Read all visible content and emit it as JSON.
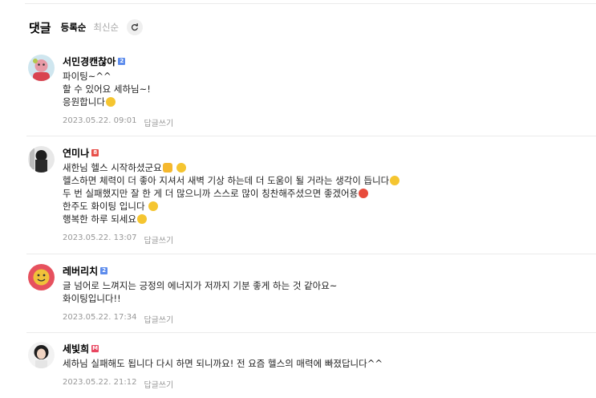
{
  "header": {
    "title": "댓글",
    "sort_options": [
      "등록순",
      "최신순"
    ],
    "active_sort": "등록순"
  },
  "comments": [
    {
      "nickname": "서민경캔찮아",
      "badge": "2",
      "badge_color": "#5d8cec",
      "lines": [
        "파이팅~^^",
        "할 수 있어요 세하님~!",
        "응원합니다"
      ],
      "date": "2023.05.22. 09:01",
      "reply_label": "답글쓰기"
    },
    {
      "nickname": "연미나",
      "badge": "8",
      "badge_color": "#e8504a",
      "lines": [
        "새한님 헬스 시작하셨군요",
        "헬스하면 체력이 더 좋아 지셔서 새벽 기상 하는데 더 도움이 될 거라는 생각이 듭니다",
        "두 번 실패했지만 잘 한 게 더 많으니까 스스로 많이 칭찬해주셨으면 좋겠어용",
        "한주도 화이팅 입니다",
        "행복한 하루 되세요"
      ],
      "date": "2023.05.22. 13:07",
      "reply_label": "답글쓰기"
    },
    {
      "nickname": "레버리치",
      "badge": "2",
      "badge_color": "#5d8cec",
      "lines": [
        "글 넘어로 느껴지는 긍정의 에너지가 저까지 기분 좋게 하는 것 같아요~",
        "화이팅입니다!!"
      ],
      "date": "2023.05.22. 17:34",
      "reply_label": "답글쓰기"
    },
    {
      "nickname": "세빛희",
      "badge": "M",
      "badge_color": "#e84660",
      "lines": [
        "세하님 실패해도 됩니다 다시 하면 되니까요! 전 요즘 헬스의 매력에 빠졌답니다^^"
      ],
      "date": "2023.05.22. 21:12",
      "reply_label": "답글쓰기"
    }
  ]
}
